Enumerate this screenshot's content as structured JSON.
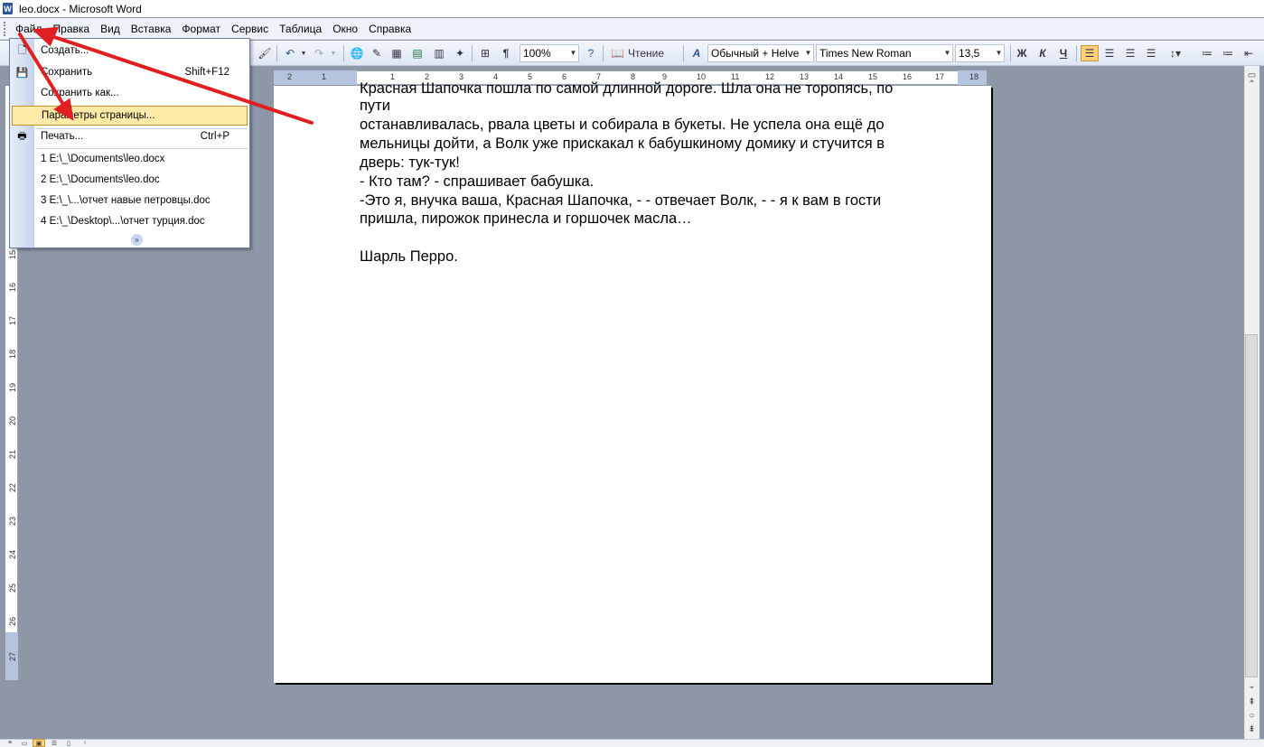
{
  "window": {
    "title": "leo.docx - Microsoft Word",
    "app_icon": "W"
  },
  "menubar": {
    "items": [
      "Файл",
      "Правка",
      "Вид",
      "Вставка",
      "Формат",
      "Сервис",
      "Таблица",
      "Окно",
      "Справка"
    ]
  },
  "toolbar": {
    "zoom": "100%",
    "reading_label": "Чтение",
    "style": "Обычный + Helve",
    "font": "Times New Roman",
    "font_size": "13,5",
    "bold_label": "Ж",
    "italic_label": "К",
    "underline_label": "Ч",
    "pilcrow": "¶"
  },
  "file_menu": {
    "items": [
      {
        "label": "Создать...",
        "shortcut": "",
        "icon": "new-document-icon"
      },
      {
        "label": "Сохранить",
        "shortcut": "Shift+F12",
        "icon": "save-icon"
      },
      {
        "label": "Сохранить как...",
        "shortcut": "",
        "icon": ""
      },
      {
        "label": "Параметры страницы...",
        "shortcut": "",
        "icon": "",
        "highlighted": true
      },
      {
        "label": "Печать...",
        "shortcut": "Ctrl+P",
        "icon": "print-icon"
      },
      {
        "label": "1 E:\\_\\Documents\\leo.docx",
        "shortcut": "",
        "icon": ""
      },
      {
        "label": "2 E:\\_\\Documents\\leo.doc",
        "shortcut": "",
        "icon": ""
      },
      {
        "label": "3 E:\\_\\...\\отчет навые петровцы.doc",
        "shortcut": "",
        "icon": ""
      },
      {
        "label": "4 E:\\_\\Desktop\\...\\отчет турция.doc",
        "shortcut": "",
        "icon": ""
      }
    ]
  },
  "document": {
    "lines": [
      "Красная Шапочка пошла по самой длинной дороге. Шла она не торопясь, по",
      "пути",
      "останавливалась, рвала цветы и собирала в букеты. Не успела она ещё до",
      "мельницы дойти, а Волк уже прискакал к бабушкиному домику и стучится в",
      "дверь: тук-тук!",
      "- Кто там? - спрашивает бабушка.",
      "-Это я, внучка ваша, Красная Шапочка, - - отвечает Волк, - - я к вам в гости",
      "пришла, пирожок принесла и горшочек масла…",
      "",
      "Шарль Перро."
    ]
  },
  "ruler": {
    "h_ticks": [
      "2",
      "1",
      "1",
      "2",
      "3",
      "4",
      "5",
      "6",
      "7",
      "8",
      "9",
      "10",
      "11",
      "12",
      "13",
      "14",
      "15",
      "16",
      "17",
      "18"
    ],
    "v_ticks": [
      "15",
      "16",
      "17",
      "18",
      "19",
      "20",
      "21",
      "22",
      "23",
      "24",
      "25",
      "26",
      "27"
    ]
  },
  "colors": {
    "annotation_arrow": "#e02020",
    "highlight": "#ffeaa8",
    "workspace": "#8d97a8"
  }
}
